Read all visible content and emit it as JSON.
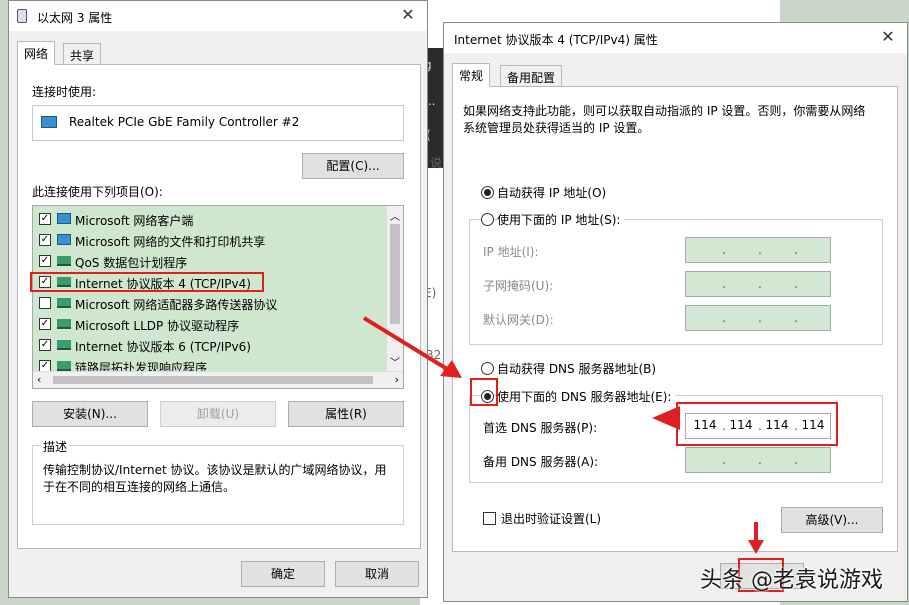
{
  "left_window": {
    "title": "以太网 3 属性",
    "tabs": [
      "网络",
      "共享"
    ],
    "connect_using_label": "连接时使用:",
    "adapter_name": "Realtek PCIe GbE Family Controller #2",
    "configure_button": "配置(C)...",
    "items_label": "此连接使用下列项目(O):",
    "items": [
      {
        "label": "Microsoft 网络客户端",
        "checked": true
      },
      {
        "label": "Microsoft 网络的文件和打印机共享",
        "checked": true
      },
      {
        "label": "QoS 数据包计划程序",
        "checked": true
      },
      {
        "label": "Internet 协议版本 4 (TCP/IPv4)",
        "checked": true
      },
      {
        "label": "Microsoft 网络适配器多路传送器协议",
        "checked": false
      },
      {
        "label": "Microsoft LLDP 协议驱动程序",
        "checked": true
      },
      {
        "label": "Internet 协议版本 6 (TCP/IPv6)",
        "checked": true
      },
      {
        "label": "链路层拓扑发现响应程序",
        "checked": true
      }
    ],
    "install_button": "安装(N)...",
    "uninstall_button": "卸载(U)",
    "properties_button": "属性(R)",
    "description_title": "描述",
    "description_text": "传输控制协议/Internet 协议。该协议是默认的广域网络协议，用于在不同的相互连接的网络上通信。",
    "ok_button": "确定",
    "cancel_button": "取消"
  },
  "right_window": {
    "title": "Internet 协议版本 4 (TCP/IPv4) 属性",
    "tabs": [
      "常规",
      "备用配置"
    ],
    "intro_text": "如果网络支持此功能，则可以获取自动指派的 IP 设置。否则，你需要从网络系统管理员处获得适当的 IP 设置。",
    "auto_ip_label": "自动获得 IP 地址(O)",
    "manual_ip_label": "使用下面的 IP 地址(S):",
    "ip_address_label": "IP 地址(I):",
    "subnet_label": "子网掩码(U):",
    "gateway_label": "默认网关(D):",
    "auto_dns_label": "自动获得 DNS 服务器地址(B)",
    "manual_dns_label": "使用下面的 DNS 服务器地址(E):",
    "preferred_dns_label": "首选 DNS 服务器(P):",
    "preferred_dns": [
      "114",
      "114",
      "114",
      "114"
    ],
    "alternate_dns_label": "备用 DNS 服务器(A):",
    "validate_label": "退出时验证设置(L)",
    "advanced_button": "高级(V)..."
  },
  "background": {
    "fragments": [
      "g",
      "...",
      "(",
      "说",
      "E)",
      "32"
    ]
  },
  "watermark": "头条 @老袁说游戏",
  "colors": {
    "highlight_green": "#cfe6cf",
    "annotation_red": "#e02020"
  }
}
